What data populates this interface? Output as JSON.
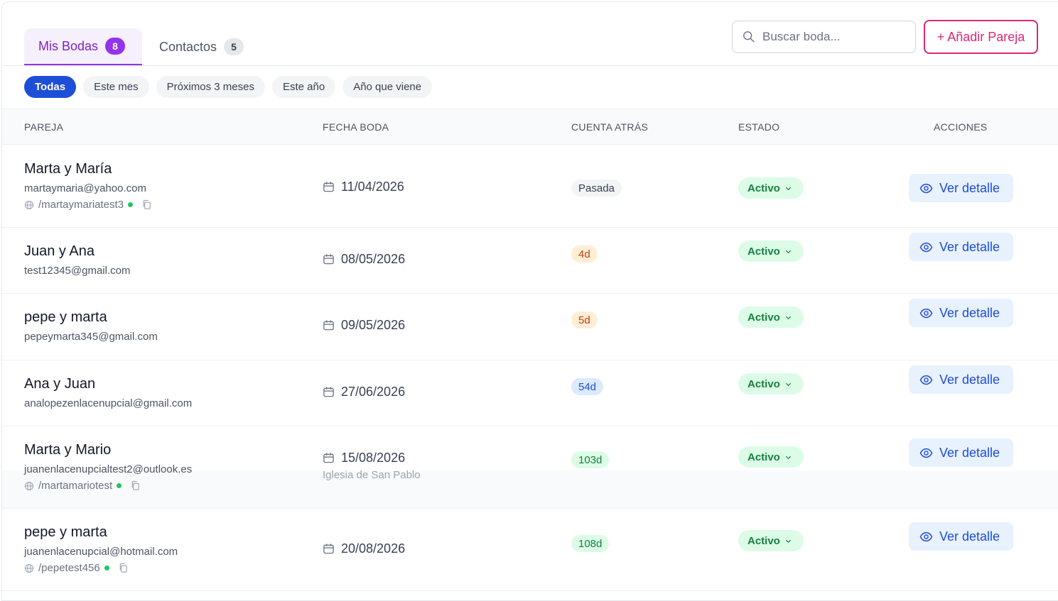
{
  "tabs": [
    {
      "label": "Mis Bodas",
      "count": "8"
    },
    {
      "label": "Contactos",
      "count": "5"
    }
  ],
  "search": {
    "placeholder": "Buscar boda..."
  },
  "add_button": "+ Añadir Pareja",
  "filters": [
    "Todas",
    "Este mes",
    "Próximos 3 meses",
    "Este año",
    "Año que viene"
  ],
  "columns": [
    "PAREJA",
    "FECHA BODA",
    "CUENTA ATRÁS",
    "ESTADO",
    "ACCIONES"
  ],
  "rows": [
    {
      "name": "Marta y María",
      "email": "martaymaria@yahoo.com",
      "slug": "/martaymariatest3",
      "date": "11/04/2026",
      "place": "",
      "countdown": "Pasada",
      "countdown_color": "#f3f4f6",
      "status": "Activo",
      "action": "Ver detalle"
    },
    {
      "name": "Juan y Ana",
      "email": "test12345@gmail.com",
      "slug": "",
      "date": "08/05/2026",
      "place": "",
      "countdown": "4d",
      "countdown_color": "#ffedd5",
      "status": "Activo",
      "action": "Ver detalle"
    },
    {
      "name": "pepe y marta",
      "email": "pepeymarta345@gmail.com",
      "slug": "",
      "date": "09/05/2026",
      "place": "",
      "countdown": "5d",
      "countdown_color": "#ffedd5",
      "status": "Activo",
      "action": "Ver detalle"
    },
    {
      "name": "Ana y Juan",
      "email": "analopezenlacenupcial@gmail.com",
      "slug": "",
      "date": "27/06/2026",
      "place": "",
      "countdown": "54d",
      "countdown_color": "#dbeafe",
      "status": "Activo",
      "action": "Ver detalle"
    },
    {
      "name": "Marta y Mario",
      "email": "juanenlacenupcialtest2@outlook.es",
      "slug": "/martamariotest",
      "date": "15/08/2026",
      "place": "Iglesia de San Pablo",
      "countdown": "103d",
      "countdown_color": "#dcfce7",
      "status": "Activo",
      "action": "Ver detalle"
    },
    {
      "name": "pepe y marta",
      "email": "juanenlacenupcial@hotmail.com",
      "slug": "/pepetest456",
      "date": "20/08/2026",
      "place": "",
      "countdown": "108d",
      "countdown_color": "#dcfce7",
      "status": "Activo",
      "action": "Ver detalle"
    }
  ]
}
